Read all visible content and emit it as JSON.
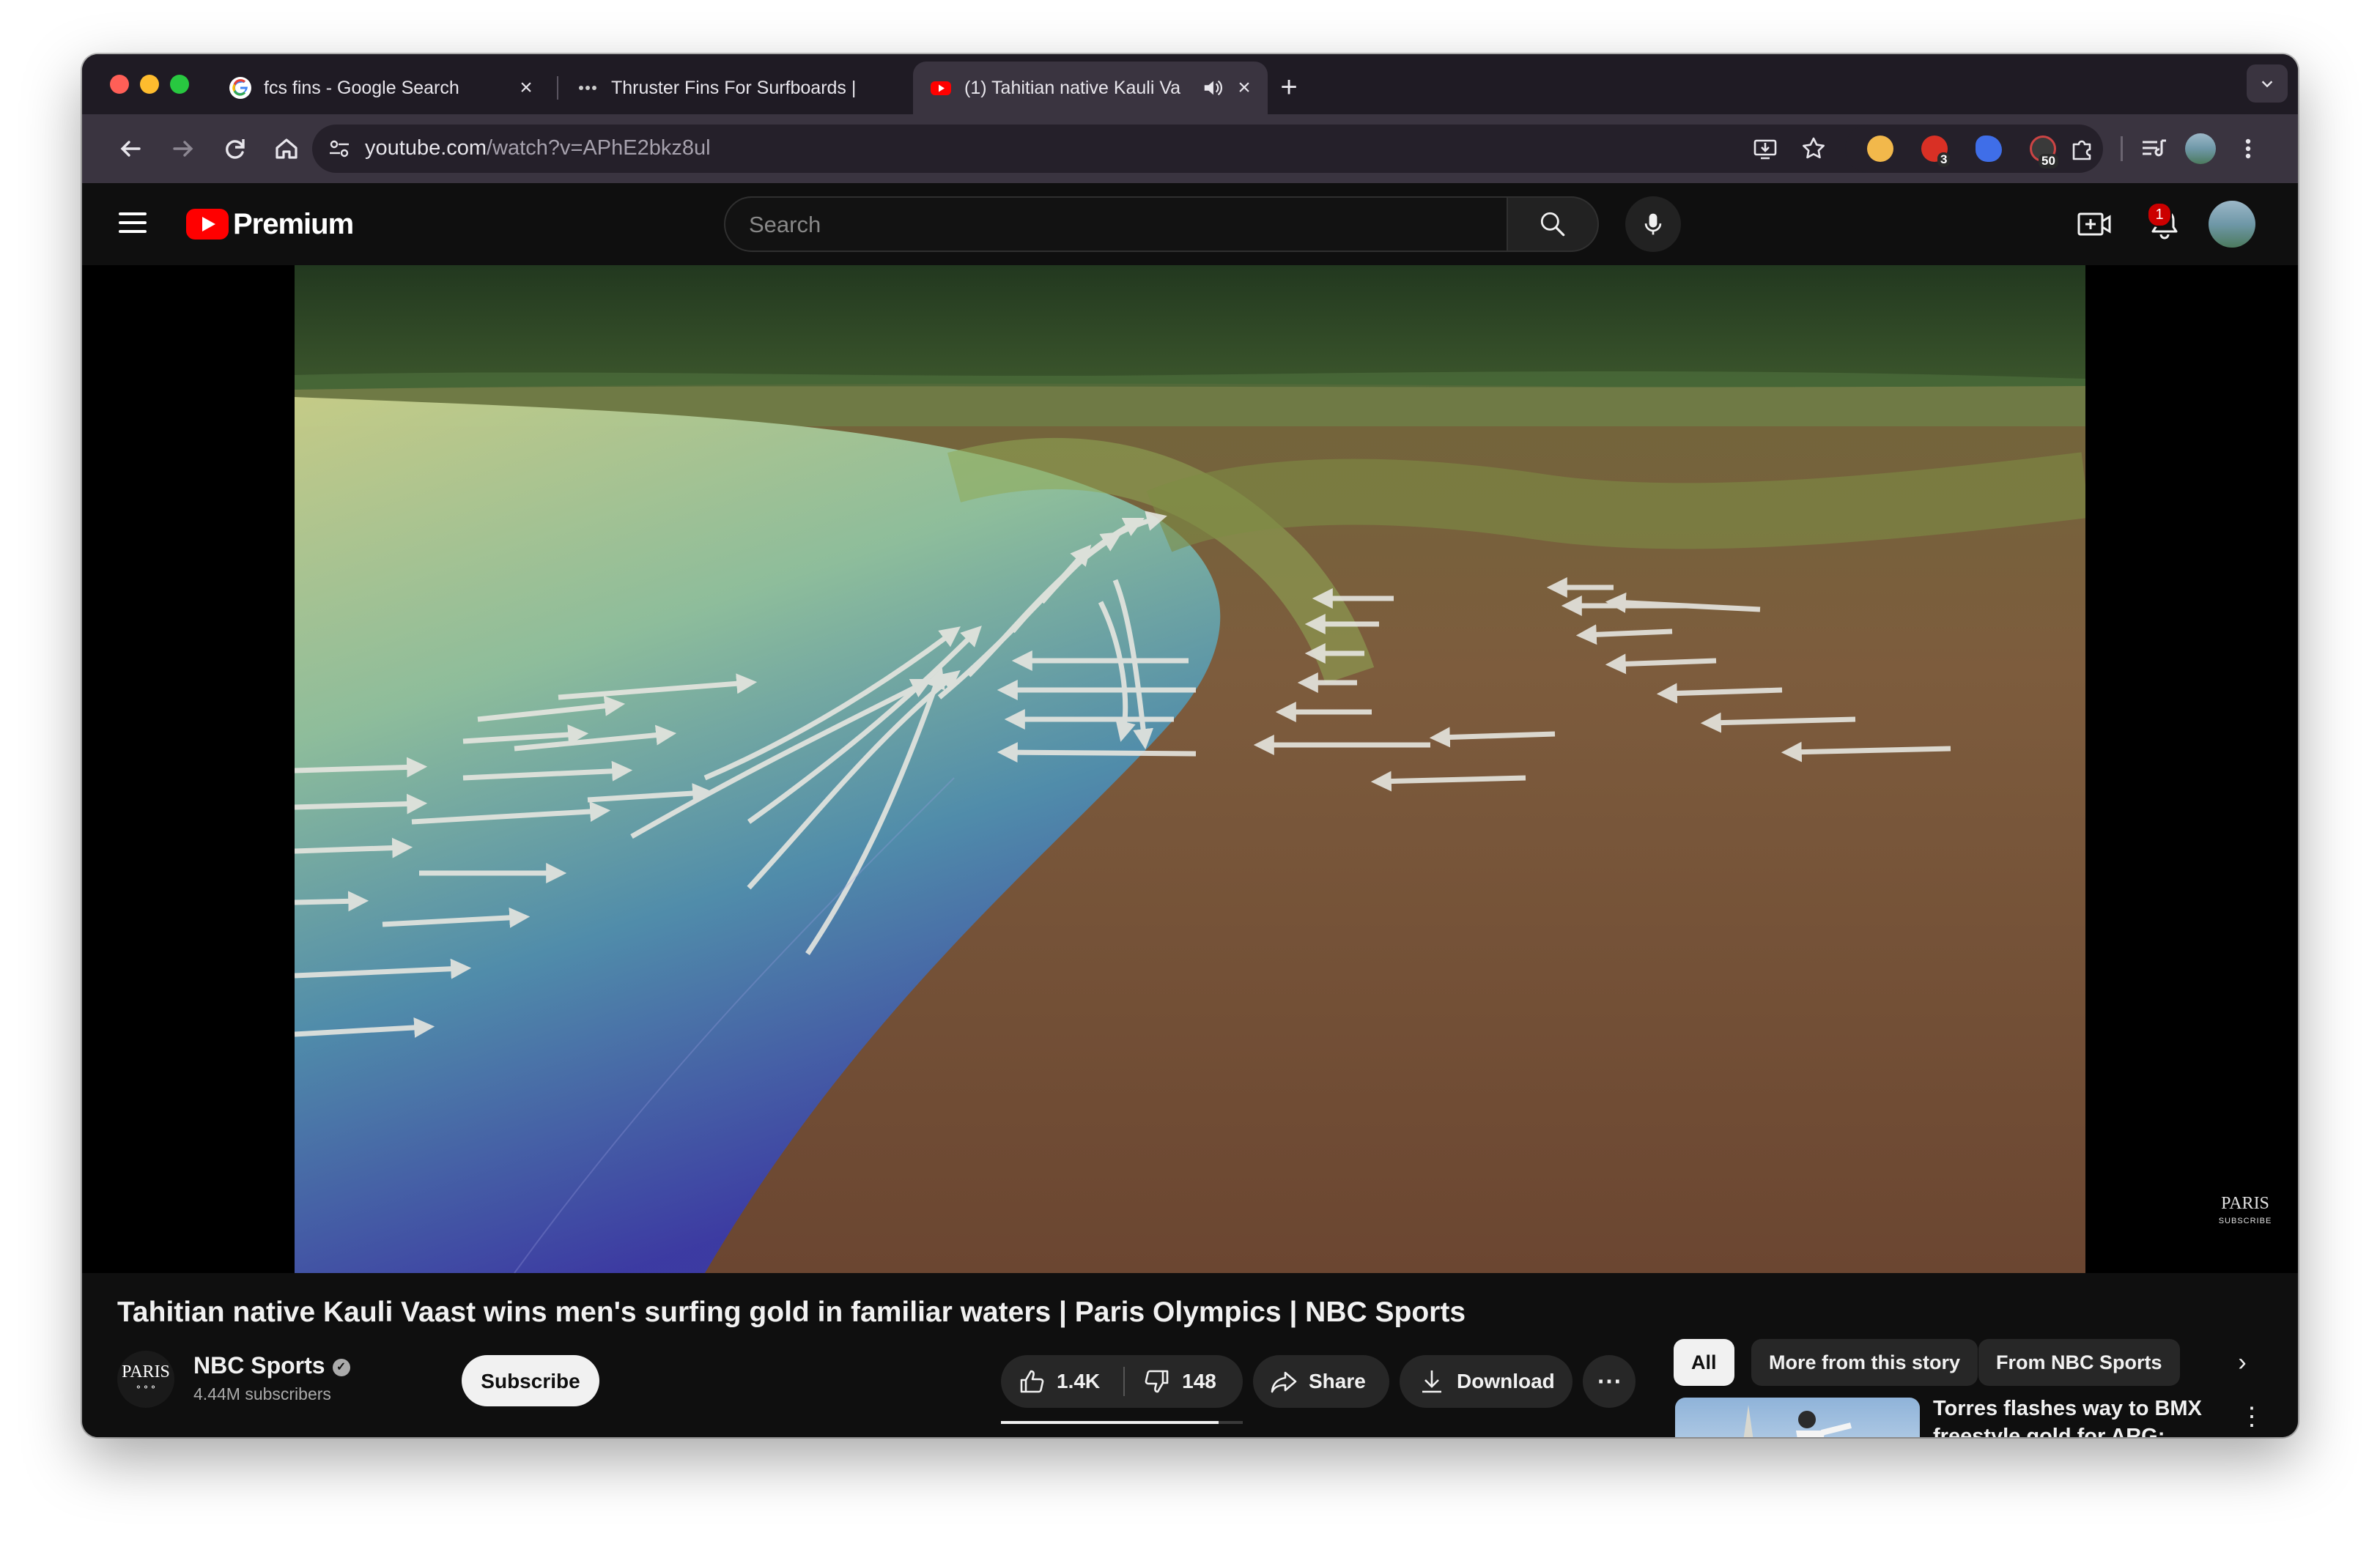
{
  "browser": {
    "tabs": [
      {
        "title": "fcs fins - Google Search",
        "favicon": "google-g-icon"
      },
      {
        "title": "Thruster Fins For Surfboards |",
        "favicon": "store-dots-icon"
      },
      {
        "title": "(1) Tahitian native Kauli Va",
        "favicon": "youtube-icon",
        "active": true,
        "audio": true
      }
    ],
    "close_glyph": "×",
    "new_tab_glyph": "+",
    "tab_menu_glyph": "⌄",
    "url_host": "youtube.com",
    "url_path": "/watch?v=APhE2bkz8ul",
    "extensions": [
      {
        "name": "moon-extension-icon",
        "color": "#f2b84b"
      },
      {
        "name": "red-extension-icon",
        "color": "#d93025",
        "badge": "3"
      },
      {
        "name": "blue-swirl-extension-icon",
        "color": "#3f6ee8"
      },
      {
        "name": "calendar-extension-icon",
        "color": "#c44",
        "badge": "50"
      }
    ]
  },
  "youtube": {
    "logo_text": "Premium",
    "search_placeholder": "Search",
    "notification_count": "1",
    "watermark_main": "PARIS",
    "watermark_sub": "SUBSCRIBE",
    "video_title": "Tahitian native Kauli Vaast wins men's surfing gold in familiar waters | Paris Olympics | NBC Sports",
    "channel": {
      "avatar_text": "PARIS",
      "name": "NBC Sports",
      "subscribers": "4.44M subscribers",
      "subscribe_label": "Subscribe"
    },
    "actions": {
      "likes": "1.4K",
      "dislikes": "148",
      "share": "Share",
      "download": "Download",
      "more": "⋯",
      "like_ratio": 0.9
    },
    "chips": [
      "All",
      "More from this story",
      "From NBC Sports"
    ],
    "chips_next": "›",
    "recommendation": {
      "title": "Torres flashes way to BMX freestyle gold for ARG; Reilly",
      "more": "⋮"
    },
    "colors": {
      "brand_red": "#ff0000",
      "background": "#0f0f0f",
      "chrome": "#3a3440"
    }
  }
}
